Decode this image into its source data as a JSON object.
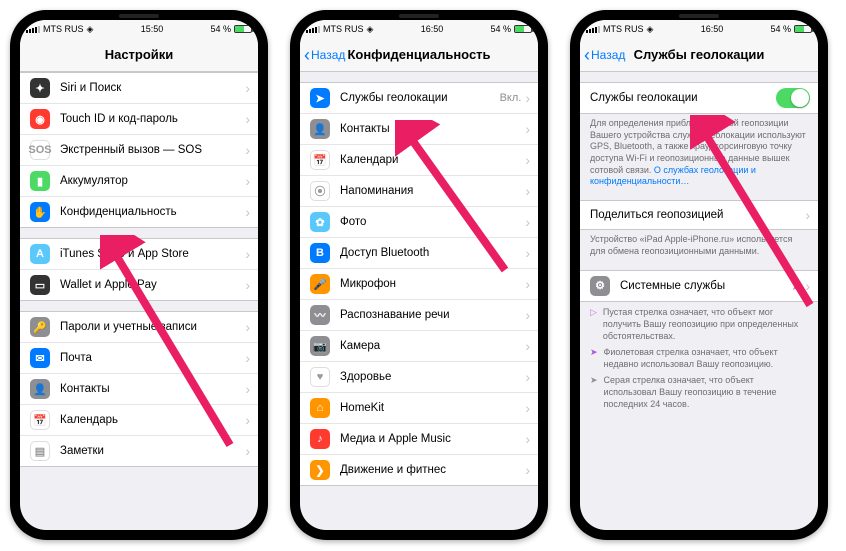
{
  "status": {
    "carrier": "MTS RUS",
    "signal_icon": "signal",
    "wifi_icon": "wifi",
    "time1": "15:50",
    "time2": "16:50",
    "time3": "16:50",
    "battery": "54 %"
  },
  "p1": {
    "title": "Настройки",
    "rows": [
      {
        "icon": "siri",
        "color": "bg-dark",
        "glyph": "✦",
        "label": "Siri и Поиск"
      },
      {
        "icon": "touchid",
        "color": "bg-red",
        "glyph": "◉",
        "label": "Touch ID и код-пароль"
      },
      {
        "icon": "sos",
        "color": "bg-white",
        "glyph": "SOS",
        "label": "Экстренный вызов — SOS"
      },
      {
        "icon": "battery",
        "color": "bg-green",
        "glyph": "▮",
        "label": "Аккумулятор"
      },
      {
        "icon": "privacy",
        "color": "bg-blue",
        "glyph": "✋",
        "label": "Конфиденциальность"
      }
    ],
    "rows2": [
      {
        "icon": "appstore",
        "color": "bg-lblue",
        "glyph": "A",
        "label": "iTunes Store и App Store"
      },
      {
        "icon": "wallet",
        "color": "bg-dark",
        "glyph": "▭",
        "label": "Wallet и Apple Pay"
      }
    ],
    "rows3": [
      {
        "icon": "passwords",
        "color": "bg-grey",
        "glyph": "🔑",
        "label": "Пароли и учетные записи"
      },
      {
        "icon": "mail",
        "color": "bg-blue",
        "glyph": "✉",
        "label": "Почта"
      },
      {
        "icon": "contacts",
        "color": "bg-grey",
        "glyph": "👤",
        "label": "Контакты"
      },
      {
        "icon": "calendar",
        "color": "bg-white",
        "glyph": "📅",
        "label": "Календарь"
      },
      {
        "icon": "notes",
        "color": "bg-white",
        "glyph": "▤",
        "label": "Заметки"
      }
    ]
  },
  "p2": {
    "back": "Назад",
    "title": "Конфиденциальность",
    "rows1": [
      {
        "icon": "location",
        "color": "bg-blue",
        "glyph": "➤",
        "label": "Службы геолокации",
        "detail": "Вкл."
      },
      {
        "icon": "contacts2",
        "color": "bg-grey",
        "glyph": "👤",
        "label": "Контакты"
      },
      {
        "icon": "calendar2",
        "color": "bg-white",
        "glyph": "📅",
        "label": "Календари"
      },
      {
        "icon": "reminders",
        "color": "bg-white",
        "glyph": "⦿",
        "label": "Напоминания"
      },
      {
        "icon": "photos",
        "color": "bg-lblue",
        "glyph": "✿",
        "label": "Фото"
      },
      {
        "icon": "bluetooth",
        "color": "bg-blue",
        "glyph": "B",
        "label": "Доступ Bluetooth"
      },
      {
        "icon": "mic",
        "color": "bg-orange",
        "glyph": "🎤",
        "label": "Микрофон"
      },
      {
        "icon": "speech",
        "color": "bg-grey",
        "glyph": "〰",
        "label": "Распознавание речи"
      },
      {
        "icon": "camera",
        "color": "bg-grey",
        "glyph": "📷",
        "label": "Камера"
      },
      {
        "icon": "health",
        "color": "bg-white",
        "glyph": "♥",
        "label": "Здоровье"
      },
      {
        "icon": "homekit",
        "color": "bg-orange",
        "glyph": "⌂",
        "label": "HomeKit"
      },
      {
        "icon": "media",
        "color": "bg-red",
        "glyph": "♪",
        "label": "Медиа и Apple Music"
      },
      {
        "icon": "motion",
        "color": "bg-orange",
        "glyph": "❯",
        "label": "Движение и фитнес"
      }
    ]
  },
  "p3": {
    "back": "Назад",
    "title": "Службы геолокации",
    "toggle_label": "Службы геолокации",
    "toggle_on": true,
    "footnote1_a": "Для определения приблизительной геопозиции Вашего устройства службы геолокации используют GPS, Bluetooth, а также краудсорсинговую точку доступа Wi-Fi и геопозиционные данные вышек сотовой связи. ",
    "footnote1_link": "О службах геолокации и конфиденциальности…",
    "share_label": "Поделиться геопозицией",
    "footnote2": "Устройство «iPad Apple-iPhone.ru» используется для обмена геопозиционными данными.",
    "system_label": "Системные службы",
    "legend": [
      {
        "color": "#c57bdd",
        "style": "hollow",
        "text": "Пустая стрелка означает, что объект мог получить Вашу геопозицию при определенных обстоятельствах."
      },
      {
        "color": "#af52de",
        "style": "solid",
        "text": "Фиолетовая стрелка означает, что объект недавно использовал Вашу геопозицию."
      },
      {
        "color": "#8e8e93",
        "style": "solid",
        "text": "Серая стрелка означает, что объект использовал Вашу геопозицию в течение последних 24 часов."
      }
    ]
  }
}
